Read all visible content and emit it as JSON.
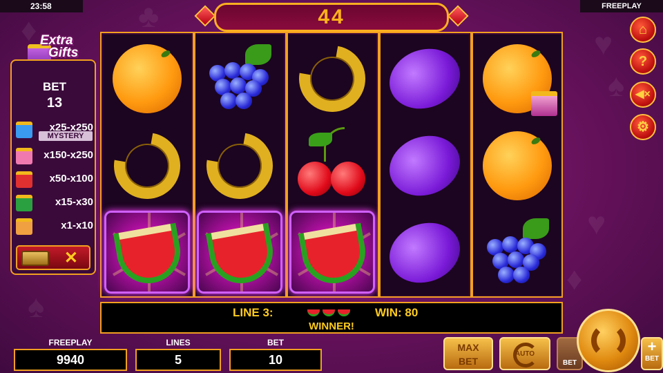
{
  "status": {
    "time": "23:58",
    "mode": "FREEPLAY"
  },
  "counter": "44",
  "extra_gifts": {
    "title_line1": "Extra",
    "title_line2": "Gifts",
    "bet_label": "BET",
    "bet_value": "13",
    "prizes": [
      {
        "range": "x25-x250",
        "color": "#3a9af0",
        "tag": "MYSTERY"
      },
      {
        "range": "x150-x250",
        "color": "#f07ab0"
      },
      {
        "range": "x50-x100",
        "color": "#e03030"
      },
      {
        "range": "x15-x30",
        "color": "#2aa040"
      },
      {
        "range": "x1-x10",
        "color": "#f0a040"
      }
    ],
    "close_symbol": "✕"
  },
  "reels": [
    [
      "orange",
      "horseshoe",
      "watermelon"
    ],
    [
      "grapes",
      "horseshoe",
      "watermelon"
    ],
    [
      "horseshoe",
      "cherry",
      "watermelon"
    ],
    [
      "plum",
      "plum",
      "plum"
    ],
    [
      "orange",
      "orange",
      "grapes"
    ]
  ],
  "win": {
    "line_label": "LINE 3:",
    "win_label": "WIN: 80",
    "message": "WINNER!"
  },
  "stats": {
    "freeplay_label": "FREEPLAY",
    "freeplay_value": "9940",
    "lines_label": "LINES",
    "lines_value": "5",
    "bet_label": "BET",
    "bet_value": "10"
  },
  "buttons": {
    "max_bet_line1": "MAX",
    "max_bet_line2": "BET",
    "auto": "AUTO",
    "bet_minus": "BET",
    "bet_plus": "BET",
    "plus": "+"
  },
  "side_icons": [
    "home-icon",
    "help-icon",
    "sound-off-icon",
    "settings-icon"
  ],
  "colors": {
    "accent": "#f2a020",
    "text_gold": "#ffcc20",
    "background": "#6e1361"
  }
}
